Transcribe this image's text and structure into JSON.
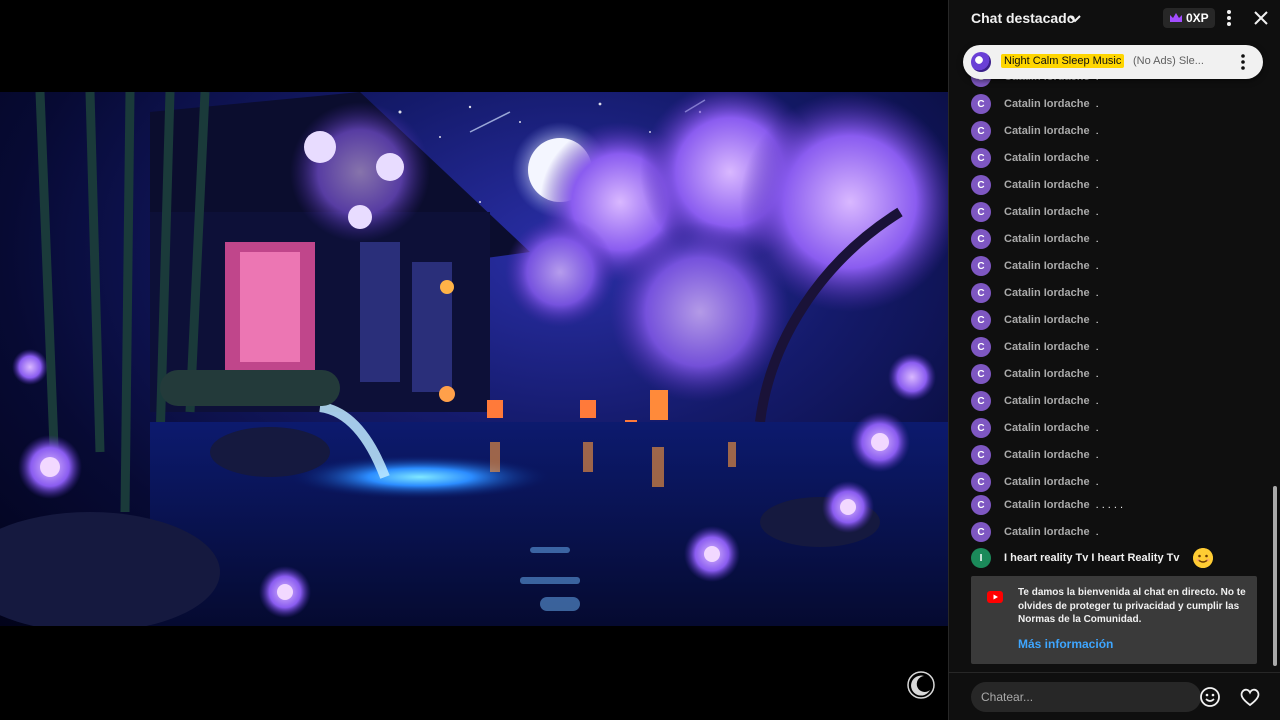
{
  "chat": {
    "title": "Chat destacado",
    "xp_badge": "0XP",
    "pinned": {
      "channel": "Night Calm Sleep Music",
      "text": "(No Ads) Sle..."
    },
    "messages": [
      {
        "avatar": "C",
        "author": "Catalin Iordache",
        "text": "."
      },
      {
        "avatar": "C",
        "author": "Catalin Iordache",
        "text": "."
      },
      {
        "avatar": "C",
        "author": "Catalin Iordache",
        "text": "."
      },
      {
        "avatar": "C",
        "author": "Catalin Iordache",
        "text": "."
      },
      {
        "avatar": "C",
        "author": "Catalin Iordache",
        "text": "."
      },
      {
        "avatar": "C",
        "author": "Catalin Iordache",
        "text": "."
      },
      {
        "avatar": "C",
        "author": "Catalin Iordache",
        "text": "."
      },
      {
        "avatar": "C",
        "author": "Catalin Iordache",
        "text": "."
      },
      {
        "avatar": "C",
        "author": "Catalin Iordache",
        "text": "."
      },
      {
        "avatar": "C",
        "author": "Catalin Iordache",
        "text": "."
      },
      {
        "avatar": "C",
        "author": "Catalin Iordache",
        "text": "."
      },
      {
        "avatar": "C",
        "author": "Catalin Iordache",
        "text": "."
      },
      {
        "avatar": "C",
        "author": "Catalin Iordache",
        "text": "."
      },
      {
        "avatar": "C",
        "author": "Catalin Iordache",
        "text": "."
      },
      {
        "avatar": "C",
        "author": "Catalin Iordache",
        "text": "."
      },
      {
        "avatar": "C",
        "author": "Catalin Iordache",
        "text": "."
      },
      {
        "avatar": "C",
        "author": "Catalin Iordache",
        "text": ". . . . ."
      },
      {
        "avatar": "C",
        "author": "Catalin Iordache",
        "text": "."
      },
      {
        "avatar": "I",
        "author": "I heart reality Tv I heart Reality Tv",
        "text": ""
      }
    ],
    "welcome": {
      "text": "Te damos la bienvenida al chat en directo. No te olvides de proteger tu privacidad y cumplir las Normas de la Comunidad.",
      "link": "Más información"
    },
    "input_placeholder": "Chatear..."
  },
  "colors": {
    "accent_link": "#3ea6ff",
    "avatar_purple": "#7e57c2",
    "avatar_green": "#1b8a5a",
    "pinned_highlight": "#ffd600",
    "panel_bg": "#0f0f0f"
  },
  "icons": {
    "header_chevron": "chevron-down-icon",
    "xp": "crown-icon",
    "more": "more-vert-icon",
    "close": "close-icon",
    "welcome": "youtube-icon",
    "emoji": "smiley-icon",
    "heart": "heart-icon",
    "last_message_emoji": "smiling-face-icon"
  }
}
